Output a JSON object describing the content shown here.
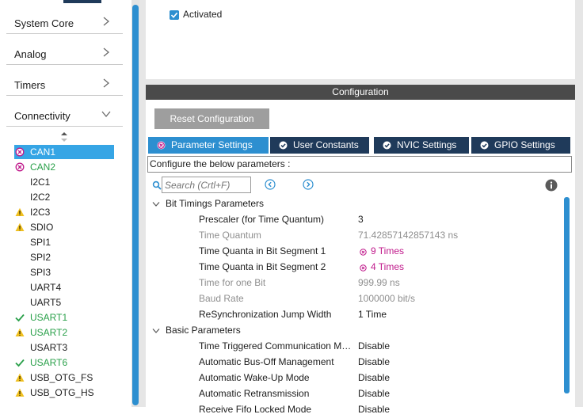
{
  "sidebar": {
    "categories": [
      {
        "label": "System Core"
      },
      {
        "label": "Analog"
      },
      {
        "label": "Timers"
      },
      {
        "label": "Connectivity"
      }
    ],
    "peripherals": [
      {
        "name": "CAN1",
        "status": "error",
        "selected": true
      },
      {
        "name": "CAN2",
        "status": "error-green"
      },
      {
        "name": "I2C1",
        "status": "none"
      },
      {
        "name": "I2C2",
        "status": "none"
      },
      {
        "name": "I2C3",
        "status": "warning"
      },
      {
        "name": "SDIO",
        "status": "warning"
      },
      {
        "name": "SPI1",
        "status": "none"
      },
      {
        "name": "SPI2",
        "status": "none"
      },
      {
        "name": "SPI3",
        "status": "none"
      },
      {
        "name": "UART4",
        "status": "none"
      },
      {
        "name": "UART5",
        "status": "none"
      },
      {
        "name": "USART1",
        "status": "ok"
      },
      {
        "name": "USART2",
        "status": "warning-green"
      },
      {
        "name": "USART3",
        "status": "none"
      },
      {
        "name": "USART6",
        "status": "ok"
      },
      {
        "name": "USB_OTG_FS",
        "status": "warning"
      },
      {
        "name": "USB_OTG_HS",
        "status": "warning"
      }
    ]
  },
  "mode": {
    "activated_label": "Activated"
  },
  "config": {
    "header": "Configuration",
    "reset_label": "Reset Configuration",
    "tabs": [
      {
        "label": "Parameter Settings",
        "icon": "error-circle-icon",
        "active": true
      },
      {
        "label": "User Constants",
        "icon": "check-circle-icon"
      },
      {
        "label": "NVIC Settings",
        "icon": "check-circle-icon"
      },
      {
        "label": "GPIO Settings",
        "icon": "check-circle-icon"
      }
    ],
    "description": "Configure the below parameters :",
    "search_placeholder": "Search (Crtl+F)",
    "groups": [
      {
        "label": "Bit Timings Parameters",
        "params": [
          {
            "name": "Prescaler (for Time Quantum)",
            "value": "3",
            "kind": "normal"
          },
          {
            "name": "Time Quantum",
            "value": "71.42857142857143 ns",
            "kind": "readonly"
          },
          {
            "name": "Time Quanta in Bit Segment 1",
            "value": "9 Times",
            "kind": "error"
          },
          {
            "name": "Time Quanta in Bit Segment 2",
            "value": "4 Times",
            "kind": "error"
          },
          {
            "name": "Time for one Bit",
            "value": "999.99 ns",
            "kind": "readonly"
          },
          {
            "name": "Baud Rate",
            "value": "1000000 bit/s",
            "kind": "readonly"
          },
          {
            "name": "ReSynchronization Jump Width",
            "value": "1 Time",
            "kind": "normal"
          }
        ]
      },
      {
        "label": "Basic Parameters",
        "params": [
          {
            "name": "Time Triggered Communication Mode",
            "value": "Disable",
            "kind": "normal"
          },
          {
            "name": "Automatic Bus-Off Management",
            "value": "Disable",
            "kind": "normal"
          },
          {
            "name": "Automatic Wake-Up Mode",
            "value": "Disable",
            "kind": "normal"
          },
          {
            "name": "Automatic Retransmission",
            "value": "Disable",
            "kind": "normal"
          },
          {
            "name": "Receive Fifo Locked Mode",
            "value": "Disable",
            "kind": "normal"
          }
        ]
      }
    ]
  },
  "colors": {
    "accent": "#2d8fd0",
    "tab_bg": "#1f3a5a",
    "error": "#c0198b",
    "warning": "#f0c020",
    "ok": "#2aa04a"
  }
}
